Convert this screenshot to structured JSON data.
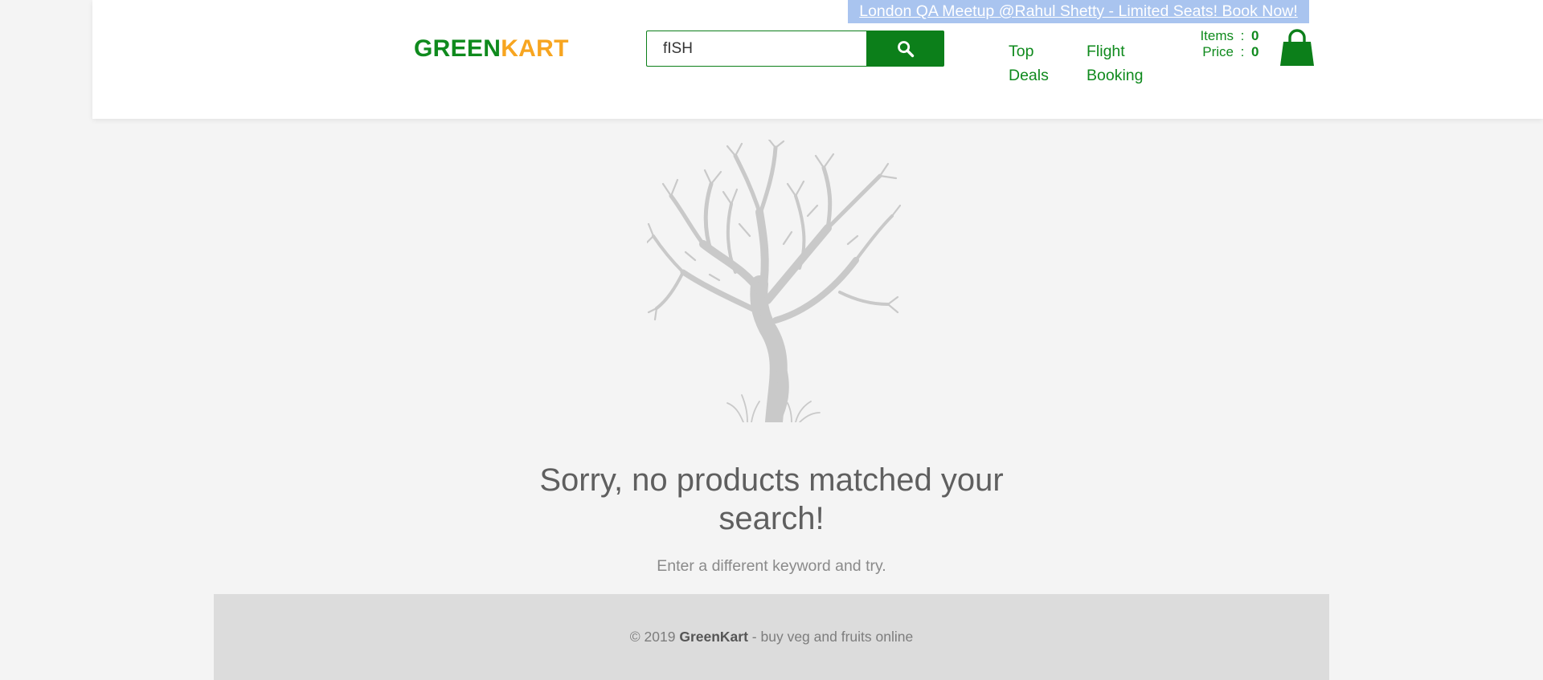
{
  "promo": {
    "text": "London QA Meetup @Rahul Shetty - Limited Seats! Book Now!"
  },
  "brand": {
    "part1": "GREEN",
    "part2": "KART",
    "color_primary": "#0f8a1d",
    "color_secondary": "#f7a520"
  },
  "search": {
    "value": "fISH",
    "button_icon": "search-icon"
  },
  "nav": {
    "top_deals_line1": "Top",
    "top_deals_line2": "Deals",
    "flight_line1": "Flight",
    "flight_line2": "Booking"
  },
  "cart": {
    "items_label": "Items",
    "items_sep": ":",
    "items_value": "0",
    "price_label": "Price",
    "price_sep": ":",
    "price_value": "0",
    "icon": "shopping-bag-icon"
  },
  "empty_state": {
    "illustration": "bare-tree-icon",
    "title": "Sorry, no products matched your search!",
    "subtitle": "Enter a different keyword and try."
  },
  "footer": {
    "prefix": "© 2019 ",
    "brand": "GreenKart",
    "suffix": " - buy veg and fruits online"
  }
}
